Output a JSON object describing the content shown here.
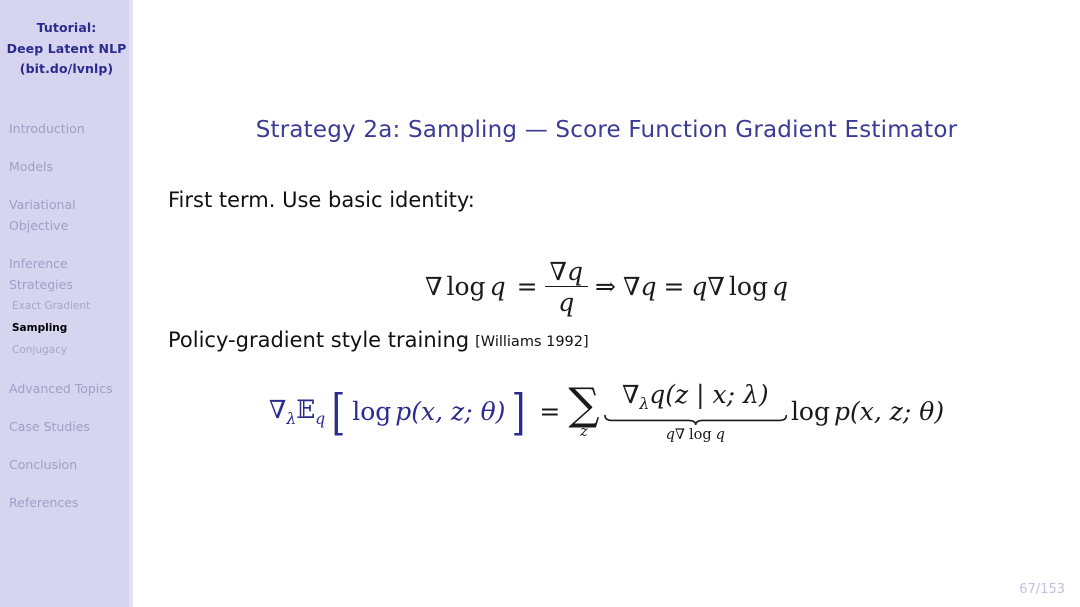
{
  "sidebar": {
    "deck_title_lines": [
      "Tutorial:",
      "Deep Latent NLP",
      "(bit.do/lvnlp)"
    ],
    "sections": [
      {
        "label": "Introduction",
        "active": false
      },
      {
        "label": "Models",
        "active": false
      },
      {
        "label": "Variational",
        "label2": "Objective",
        "active": false
      },
      {
        "label": "Inference",
        "label2": "Strategies",
        "active": true
      },
      {
        "label": "Advanced Topics",
        "active": false
      },
      {
        "label": "Case Studies",
        "active": false
      },
      {
        "label": "Conclusion",
        "active": false
      },
      {
        "label": "References",
        "active": false
      }
    ],
    "subsections": [
      {
        "label": "Exact Gradient",
        "active": false
      },
      {
        "label": "Sampling",
        "active": true
      },
      {
        "label": "Conjugacy",
        "active": false
      }
    ],
    "colors": {
      "background": "#d6d4ef",
      "title_text": "#2b2b8f",
      "item_text": "#9f9ec6",
      "active_text": "#000000"
    }
  },
  "slide": {
    "title": "Strategy 2a: Sampling — Score Function Gradient Estimator",
    "line1": "First term.  Use basic identity:",
    "line2": "Policy-gradient style training",
    "line2_citation": "[Williams 1992]",
    "page_number": "67/153",
    "accent_color": "#3b3b96"
  },
  "equation1": {
    "nabla": "∇",
    "log": "log",
    "q": "q",
    "equals": "=",
    "numerator_nabla": "∇",
    "numerator_q": "q",
    "denominator_q": "q",
    "implies": "⇒",
    "rhs_nabla": "∇",
    "rhs_q": "q",
    "rhs_equals": "=",
    "rhs_q2": "q",
    "rhs_nabla2": "∇",
    "rhs_log": "log",
    "rhs_q3": "q"
  },
  "equation2": {
    "grad_symbol": "∇",
    "grad_sub": "λ",
    "expectation": "𝔼",
    "expectation_sub": "q",
    "bracket_open": "[",
    "log": "log",
    "p": "p",
    "p_args": "(x, z; θ)",
    "bracket_close": "]",
    "equals": "=",
    "sum_symbol": "∑",
    "sum_sub": "z",
    "ub_grad": "∇",
    "ub_grad_sub": "λ",
    "ub_q": "q",
    "ub_q_args": "(z | x; λ)",
    "underbrace_label_q": "q",
    "underbrace_label_nabla": "∇",
    "underbrace_label_log": "log",
    "underbrace_label_q2": "q",
    "tail_log": "log",
    "tail_p": "p",
    "tail_args": "(x, z; θ)",
    "blue_color": "#2b2b8f"
  }
}
